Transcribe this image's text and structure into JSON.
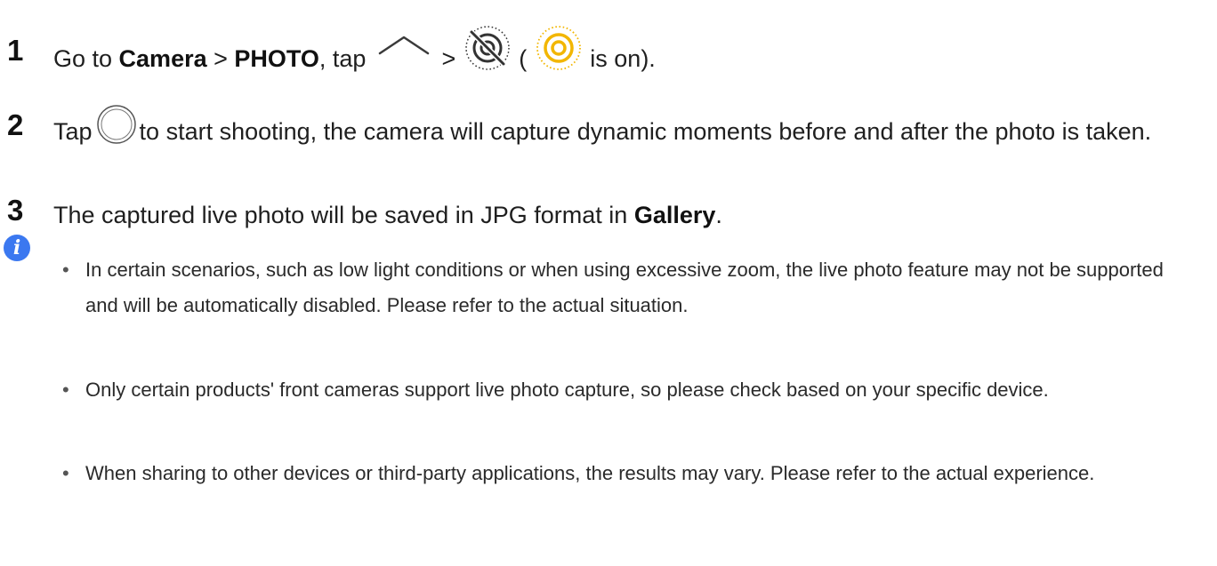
{
  "steps": [
    {
      "number": "1",
      "parts": {
        "go_to": "Go to ",
        "camera": "Camera",
        "sep1": " > ",
        "photo": "PHOTO",
        "tap": ", tap ",
        "sep2": " > ",
        "paren_open": " ( ",
        "is_on": " is on)."
      },
      "icons": [
        "chevron-up-icon",
        "live-photo-off-icon",
        "live-photo-on-icon"
      ]
    },
    {
      "number": "2",
      "parts": {
        "tap": "Tap ",
        "rest": " to start shooting, the camera will capture dynamic moments before and after the photo is taken."
      },
      "icons": [
        "shutter-button-icon"
      ]
    },
    {
      "number": "3",
      "parts": {
        "before": "The captured live photo will be saved in JPG format in ",
        "gallery": "Gallery",
        "after": "."
      }
    }
  ],
  "notes": [
    "In certain scenarios, such as low light conditions or when using excessive zoom, the live photo feature may not be supported and will be automatically disabled. Please refer to the actual situation.",
    "Only certain products' front cameras support live photo capture, so please check based on your specific device.",
    "When sharing to other devices or third-party applications, the results may vary. Please refer to the actual experience."
  ],
  "info_icon_glyph": "i",
  "bullet_glyph": "•",
  "colors": {
    "info_icon": "#3b78f0",
    "live_on_icon": "#f2b600",
    "text": "#1f1f1f"
  }
}
